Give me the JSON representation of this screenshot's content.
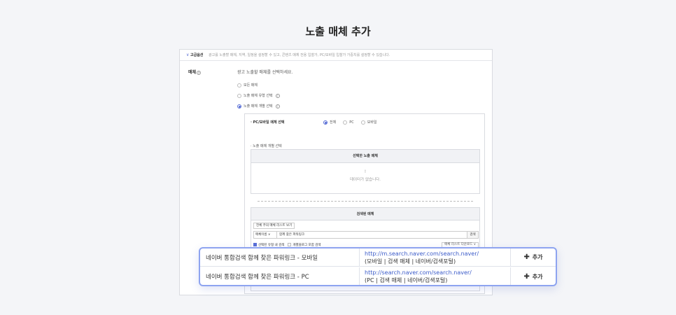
{
  "page_title": "노출 매체 추가",
  "advanced": {
    "chevron_icon": "chevron-down-icon",
    "label": "고급옵션",
    "description": "광고를 노출할 매체, 지역, 일정을 설정할 수 있고, 콘텐츠 매체 전용 입찰가, PC/모바일 입찰가 가중치를 설정할 수 있습니다."
  },
  "media": {
    "label": "매체",
    "help_icon": "?",
    "description": "광고 노출할 매체를 선택하세요.",
    "options": [
      {
        "label": "모든 매체",
        "selected": false
      },
      {
        "label": "노출 매체 유형 선택",
        "selected": false
      },
      {
        "label": "노출 매체 개별 선택",
        "selected": true
      }
    ]
  },
  "device": {
    "label": "· PC/모바일 매체 선택",
    "options": [
      {
        "label": "전체",
        "selected": true
      },
      {
        "label": "PC",
        "selected": false
      },
      {
        "label": "모바일",
        "selected": false
      }
    ]
  },
  "individual_label": "· 노출 매체 개별 선택",
  "selected_table": {
    "header": "선택한 노출 매체",
    "empty_icon": "!",
    "empty_text": "데이터가 없습니다."
  },
  "search_table": {
    "header": "검색된 매체",
    "all_button": "전체 주의 매체 리스트 보기",
    "select_value": "매체이름",
    "input_value": "함께 찾은 파워링크",
    "search_button": "검색",
    "check_in_type": "선택된 유형 내 검색",
    "check_individual": "개별블로그 포함 검색",
    "download_button": "매체 리스트 다운로드"
  },
  "popup": {
    "rows": [
      {
        "name": "네이버 통합검색 함께 찾은 파워링크 - 모바일",
        "url": "http://m.search.naver.com/search.naver/",
        "category": "(모바일 | 검색 매체 | 네이버/검색포털)",
        "add_label": "추가"
      },
      {
        "name": "네이버 통합검색 함께 찾은 파워링크 - PC",
        "url": "http://search.naver.com/search.naver/",
        "category": "(PC | 검색 매체 | 네이버/검색포털)",
        "add_label": "추가"
      }
    ]
  },
  "colors": {
    "accent": "#5a6fd6",
    "popup_border": "#8ea4f0",
    "link": "#3b5bc9"
  }
}
